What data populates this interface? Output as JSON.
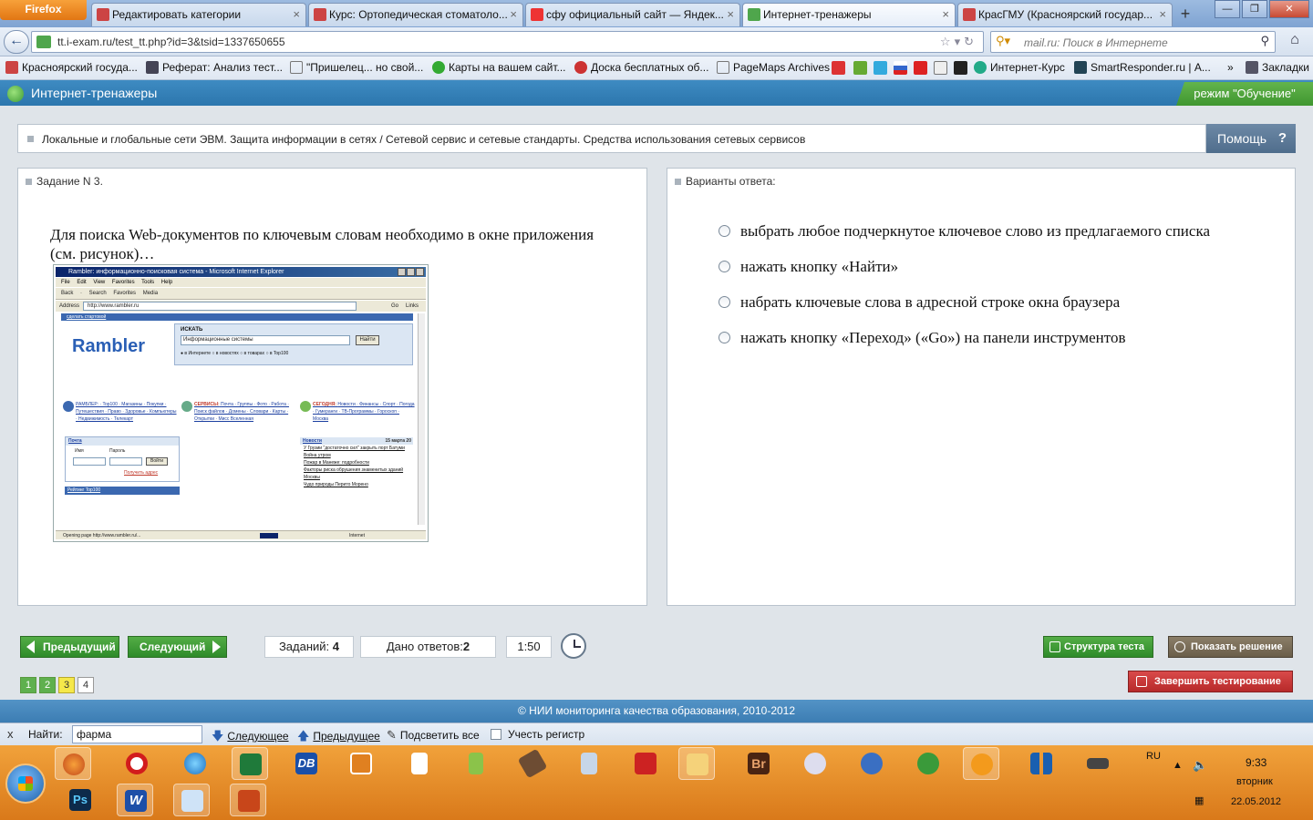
{
  "browser": {
    "menu_button": "Firefox",
    "tabs": [
      {
        "label": "Редактировать категории",
        "active": false
      },
      {
        "label": "Курс: Ортопедическая стоматоло...",
        "active": false
      },
      {
        "label": "сфу официальный сайт — Яндек...",
        "active": false
      },
      {
        "label": "Интернет-тренажеры",
        "active": true
      },
      {
        "label": "КрасГМУ (Красноярский государ...",
        "active": false
      }
    ],
    "new_tab": "+",
    "url": "tt.i-exam.ru/test_tt.php?id=3&tsid=1337650655",
    "search_placeholder": "mail.ru: Поиск в Интернете",
    "bookmarks": [
      "Красноярский госуда...",
      "Реферат: Анализ тест...",
      "\"Пришелец... но свой...",
      "Карты на вашем сайт...",
      "Доска бесплатных об...",
      "PageMaps Archives",
      "Интернет-Курс",
      "SmartResponder.ru | А...",
      "Закладки"
    ],
    "bookmarks_overflow": "»"
  },
  "app": {
    "title": "Интернет-тренажеры",
    "mode": "режим \"Обучение\"",
    "topic": "Локальные и глобальные сети ЭВМ. Защита информации в сетях / Сетевой сервис и сетевые стандарты. Средства использования сетевых сервисов",
    "help_label": "Помощь",
    "help_icon": "?"
  },
  "task": {
    "header": "Задание N 3.",
    "question": "Для поиска Web-документов по ключевым словам необходимо в окне приложения (см. рисунок)…",
    "screenshot": {
      "window_title": "Rambler: информационно-поисковая система - Microsoft Internet Explorer",
      "menu": "File Edit View Favorites Tools Help",
      "toolbar": "Back · Search Favorites Media",
      "address_label": "Address",
      "address_value": "http://www.rambler.ru",
      "go_label": "Go",
      "links_label": "Links",
      "start_page_link": "сделать стартовой",
      "logo": "Rambler",
      "search_label": "ИСКАТЬ",
      "search_value": "Информационные системы",
      "search_button": "Найти",
      "search_options": "● в Интернете ○ в новостях ○ в товарах ○ в Top100",
      "col1": "РАМБЛЕР: · Top100 · Магазины · Покупки · Путешествия · Право · Здоровье · Компьютеры · Недвижимость · Телекарт",
      "col1_head": "РАМБЛЕР:",
      "col2_head": "СЕРВИСЫ:",
      "col2": "Почта · Группы · Фото · Работа · Поиск файлов · Домены · Словари · Карты · Открытки · Мисс Вселенная",
      "col3_head": "СЕГОДНЯ:",
      "col3": "Новости · Финансы · Спорт · Погода · Гумеранги · ТВ-Программы · Гороскоп · Москва",
      "mail_header": "Почта",
      "mail_name": "Имя",
      "mail_pass": "Пароль",
      "mail_login": "Войти",
      "mail_register": "Получить адрес",
      "top100": "Рейтинг Top100",
      "news_header": "Новости",
      "news_date": "15 марта 20",
      "news_items": [
        "У Грузии \"достаточно сил\" закрыть порт Батуми",
        "Война утром",
        "Пожар в Манеже: подробности",
        "Факторы риска обрушения знаменитых зданий Москвы",
        "Чудо природы Перито Морено"
      ],
      "status_text": "Opening page http://www.rambler.ru/...",
      "status_zone": "Internet"
    }
  },
  "answers": {
    "header": "Варианты ответа:",
    "options": [
      "выбрать любое подчеркнутое ключевое слово из предлагаемого списка",
      "нажать кнопку «Найти»",
      "набрать ключевые слова в адресной строке окна браузера",
      "нажать кнопку «Переход» («Go») на панели инструментов"
    ]
  },
  "controls": {
    "prev": "Предыдущий",
    "next": "Следующий",
    "tasks_label": "Заданий:",
    "tasks_count": "4",
    "answered_label": "Дано ответов:",
    "answered_count": "2",
    "timer": "1:50",
    "structure": "Структура теста",
    "show_solution": "Показать решение",
    "finish": "Завершить тестирование",
    "pages": [
      {
        "label": "1",
        "state": "answered"
      },
      {
        "label": "2",
        "state": "answered"
      },
      {
        "label": "3",
        "state": "current"
      },
      {
        "label": "4",
        "state": "pending"
      }
    ]
  },
  "footer": "© НИИ мониторинга качества образования, 2010-2012",
  "findbar": {
    "close": "x",
    "label": "Найти:",
    "value": "фарма",
    "next": "Следующее",
    "prev": "Предыдущее",
    "highlight": "Подсветить все",
    "match_case": "Учесть регистр"
  },
  "taskbar": {
    "lang": "RU",
    "time": "9:33",
    "day": "вторник",
    "date": "22.05.2012",
    "ps_label": "Ps",
    "br_label": "Br",
    "db_label": "DB",
    "word_label": "W"
  },
  "colors": {
    "header_blue": "#2c76ad",
    "mode_green": "#3f9630",
    "accent_green": "#2e8b2a",
    "taskbar_orange": "#d9791a"
  }
}
